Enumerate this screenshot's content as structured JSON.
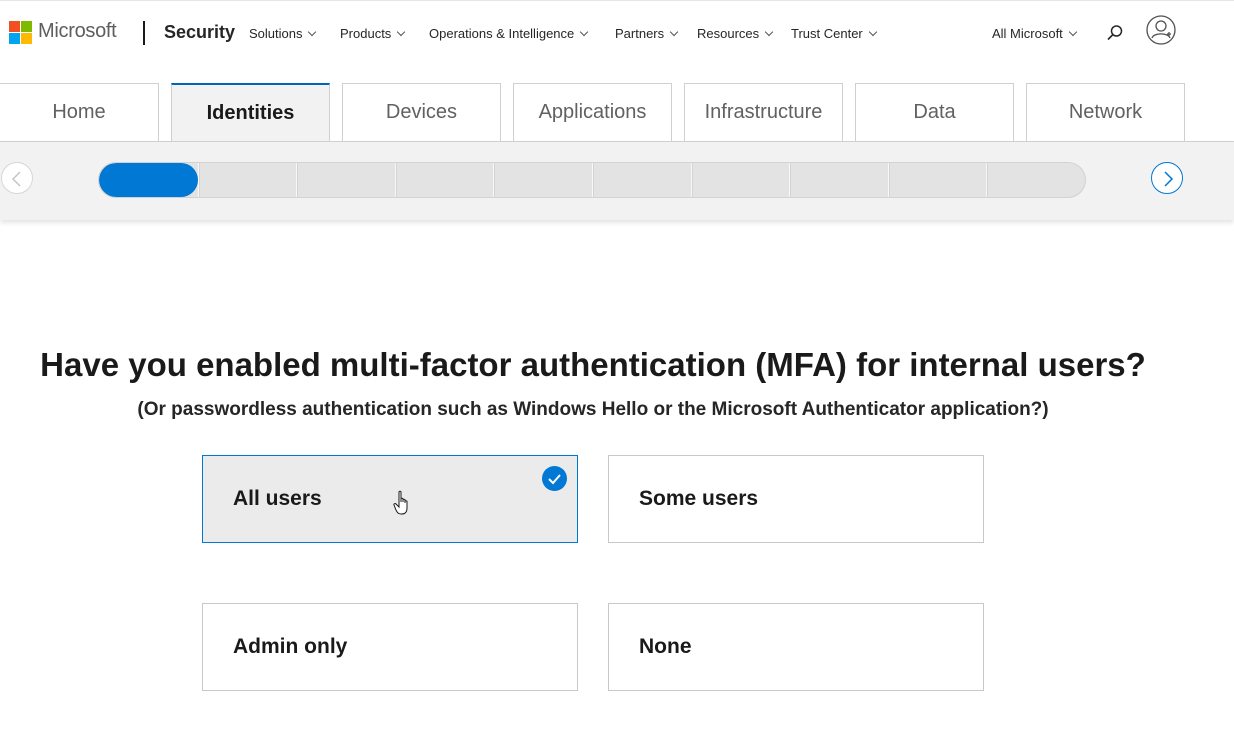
{
  "header": {
    "brand": "Microsoft",
    "site_name": "Security",
    "nav": [
      "Solutions",
      "Products",
      "Operations & Intelligence",
      "Partners",
      "Resources",
      "Trust Center"
    ],
    "all_microsoft": "All Microsoft",
    "icons": {
      "logo": "microsoft-logo",
      "search": "search-icon",
      "account": "account-icon"
    }
  },
  "tabs": [
    {
      "label": "Home",
      "active": false
    },
    {
      "label": "Identities",
      "active": true
    },
    {
      "label": "Devices",
      "active": false
    },
    {
      "label": "Applications",
      "active": false
    },
    {
      "label": "Infrastructure",
      "active": false
    },
    {
      "label": "Data",
      "active": false
    },
    {
      "label": "Network",
      "active": false
    }
  ],
  "progress": {
    "total_steps": 10,
    "completed_steps": 1,
    "prev_icon": "chevron-left-icon",
    "next_icon": "chevron-right-icon"
  },
  "question": {
    "title": "Have you enabled multi-factor authentication (MFA) for internal users?",
    "subtitle": "(Or passwordless authentication such as Windows Hello or the Microsoft Authenticator application?)"
  },
  "answers": [
    {
      "label": "All users",
      "selected": true
    },
    {
      "label": "Some users",
      "selected": false
    },
    {
      "label": "Admin only",
      "selected": false
    },
    {
      "label": "None",
      "selected": false
    }
  ],
  "colors": {
    "accent": "#0078d4",
    "selected_bg": "#ebebeb",
    "band_bg": "#f2f2f2",
    "track_bg": "#e3e3e3"
  }
}
